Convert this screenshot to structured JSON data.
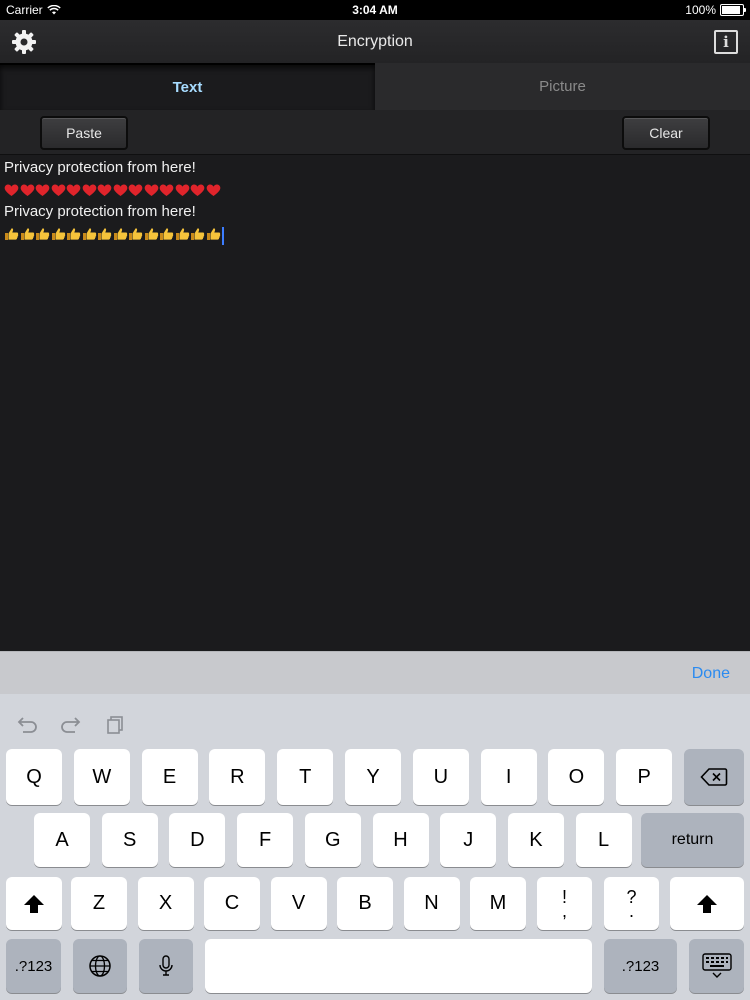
{
  "status": {
    "carrier": "Carrier",
    "time": "3:04 AM",
    "battery": "100%",
    "battery_level": 1.0
  },
  "nav": {
    "title": "Encryption",
    "settings_icon": "gear-icon",
    "info_icon": "info-icon",
    "info_glyph": "i"
  },
  "tabs": [
    {
      "label": "Text",
      "active": true
    },
    {
      "label": "Picture",
      "active": false
    }
  ],
  "toolbar": {
    "paste_label": "Paste",
    "clear_label": "Clear"
  },
  "editor": {
    "line1": "Privacy protection from here!",
    "hearts_count": 14,
    "line3": "Privacy protection from here!",
    "thumbs_count": 14
  },
  "accessory": {
    "done_label": "Done"
  },
  "keyboard": {
    "row1": [
      "Q",
      "W",
      "E",
      "R",
      "T",
      "Y",
      "U",
      "I",
      "O",
      "P"
    ],
    "row2": [
      "A",
      "S",
      "D",
      "F",
      "G",
      "H",
      "J",
      "K",
      "L"
    ],
    "row3": [
      "Z",
      "X",
      "C",
      "V",
      "B",
      "N",
      "M"
    ],
    "return_label": "return",
    "numbers_label": ".?123",
    "punct1_top": "!",
    "punct1_bottom": ",",
    "punct2_top": "?",
    "punct2_bottom": "."
  },
  "colors": {
    "accent": "#2b8bf0",
    "active_tab_text": "#a7dcff",
    "heart": "#e0242b",
    "thumb": "#f5c33b"
  }
}
